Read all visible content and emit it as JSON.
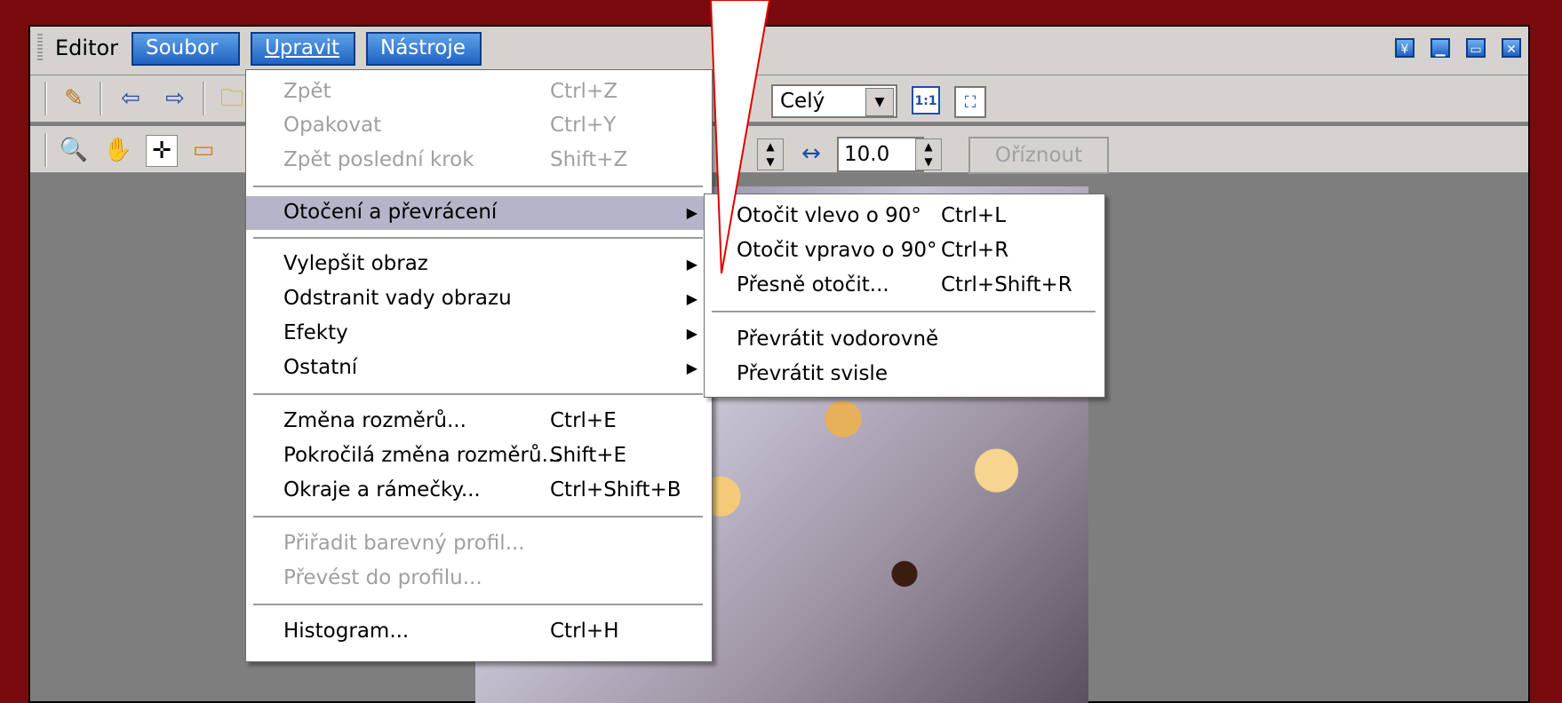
{
  "titlebar": {
    "editor_label": "Editor",
    "menus": [
      "Soubor",
      "Upravit",
      "Nástroje"
    ],
    "window_controls": [
      "collapse-icon",
      "minimize-icon",
      "restore-icon",
      "close-icon"
    ]
  },
  "toolbar1": {
    "icons": [
      "brush-icon",
      "back-arrow-icon",
      "forward-arrow-icon",
      "open-folder-icon"
    ],
    "zoom_select": "Celý",
    "actual_size_label": "1:1",
    "fit_icon": "fit-screen-icon"
  },
  "toolbar2": {
    "icons": [
      "zoom-icon",
      "hand-icon",
      "crosshair-icon",
      "ruler-icon"
    ],
    "width_icon": "width-arrows-icon",
    "value": "10.0",
    "crop_label": "Oříznout"
  },
  "edit_menu": {
    "items": [
      {
        "label": "Zpět",
        "shortcut": "Ctrl+Z"
      },
      {
        "label": "Opakovat",
        "shortcut": "Ctrl+Y"
      },
      {
        "label": "Zpět poslední krok",
        "shortcut": "Shift+Z"
      },
      {
        "label": "Otočení a převrácení",
        "shortcut": ""
      },
      {
        "label": "Vylepšit obraz",
        "shortcut": ""
      },
      {
        "label": "Odstranit vady obrazu",
        "shortcut": ""
      },
      {
        "label": "Efekty",
        "shortcut": ""
      },
      {
        "label": "Ostatní",
        "shortcut": ""
      },
      {
        "label": "Změna rozměrů...",
        "shortcut": "Ctrl+E"
      },
      {
        "label": "Pokročilá změna rozměrů...",
        "shortcut": "Shift+E"
      },
      {
        "label": "Okraje a rámečky...",
        "shortcut": "Ctrl+Shift+B"
      },
      {
        "label": "Přiřadit barevný profil...",
        "shortcut": ""
      },
      {
        "label": "Převést do profilu...",
        "shortcut": ""
      },
      {
        "label": "Histogram...",
        "shortcut": "Ctrl+H"
      }
    ]
  },
  "rotate_submenu": {
    "items": [
      {
        "label": "Otočit vlevo o 90°",
        "shortcut": "Ctrl+L"
      },
      {
        "label": "Otočit vpravo o 90°",
        "shortcut": "Ctrl+R"
      },
      {
        "label": "Přesně otočit...",
        "shortcut": "Ctrl+Shift+R"
      },
      {
        "label": "Převrátit vodorovně",
        "shortcut": ""
      },
      {
        "label": "Převrátit svisle",
        "shortcut": ""
      }
    ]
  },
  "colors": {
    "background": "#7a0a0c",
    "highlight": "#b6b4c8",
    "menu_button": "#1f64c5",
    "callout_line": "#e00000"
  }
}
